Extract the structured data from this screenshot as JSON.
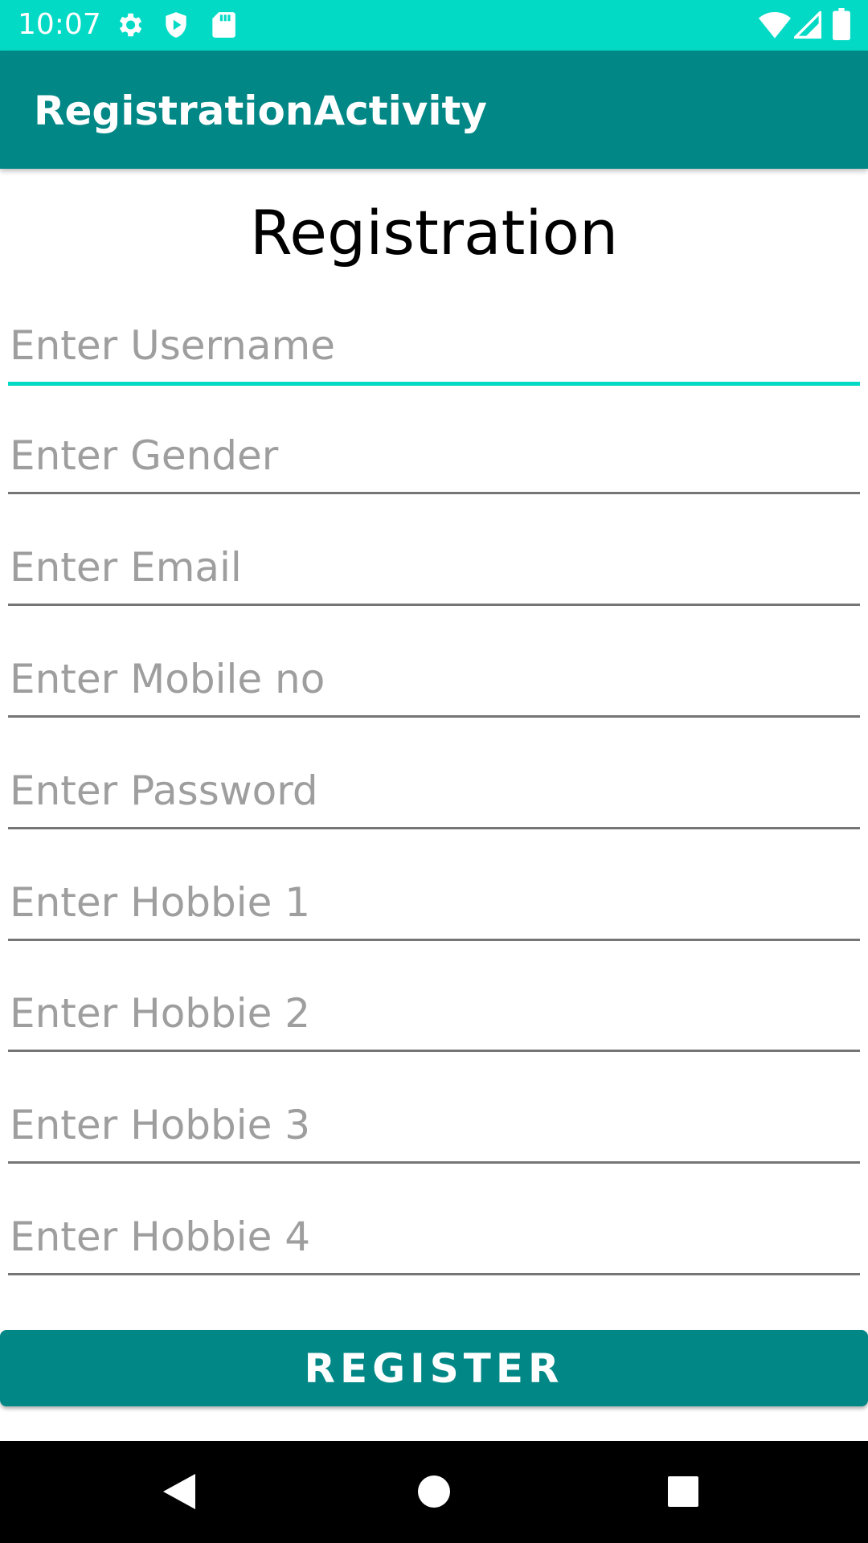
{
  "status_bar": {
    "time": "10:07",
    "icons_left": [
      "settings-icon",
      "shield-play-icon",
      "sd-card-icon"
    ],
    "icons_right": [
      "wifi-icon",
      "cellular-signal-icon",
      "battery-icon"
    ],
    "background": "#03dac5"
  },
  "app_bar": {
    "title": "RegistrationActivity",
    "background": "#018786"
  },
  "form": {
    "heading": "Registration",
    "fields": [
      {
        "placeholder": "Enter Username",
        "value": "",
        "focused": true
      },
      {
        "placeholder": "Enter Gender",
        "value": ""
      },
      {
        "placeholder": "Enter Email",
        "value": ""
      },
      {
        "placeholder": "Enter Mobile no",
        "value": ""
      },
      {
        "placeholder": "Enter Password",
        "value": ""
      },
      {
        "placeholder": "Enter Hobbie 1",
        "value": ""
      },
      {
        "placeholder": "Enter Hobbie 2",
        "value": ""
      },
      {
        "placeholder": "Enter Hobbie 3",
        "value": ""
      },
      {
        "placeholder": "Enter Hobbie 4",
        "value": ""
      }
    ],
    "accent_color": "#03dac5",
    "submit_label": "REGISTER"
  },
  "nav_bar": {
    "buttons": [
      "back-icon",
      "home-icon",
      "recents-icon"
    ]
  }
}
